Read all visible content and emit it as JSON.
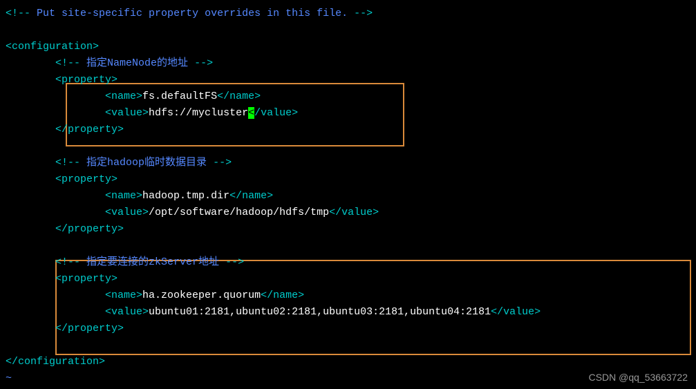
{
  "comments": {
    "site_specific": "Put site-specific property overrides in this file.",
    "namenode": "指定NameNode的地址",
    "tmp_dir": "指定hadoop临时数据目录",
    "zk_server": "指定要连接的zkServer地址"
  },
  "properties": [
    {
      "name": "fs.defaultFS",
      "value": "hdfs://mycluster"
    },
    {
      "name": "hadoop.tmp.dir",
      "value": "/opt/software/hadoop/hdfs/tmp"
    },
    {
      "name": "ha.zookeeper.quorum",
      "value": "ubuntu01:2181,ubuntu02:2181,ubuntu03:2181,ubuntu04:2181"
    }
  ],
  "tags": {
    "configuration_open": "<configuration>",
    "configuration_close": "</configuration>",
    "property_open": "<property>",
    "property_close": "</property>",
    "name_open": "<name>",
    "name_close": "</name>",
    "value_open": "<value>",
    "value_close": "</value>",
    "comment_open": "<!-- ",
    "comment_close": " -->",
    "excl": "<!",
    "lt": "<",
    "gt": ">",
    "slash_value_gt": "/value>"
  },
  "tilde": "~",
  "watermark": "CSDN @qq_53663722"
}
